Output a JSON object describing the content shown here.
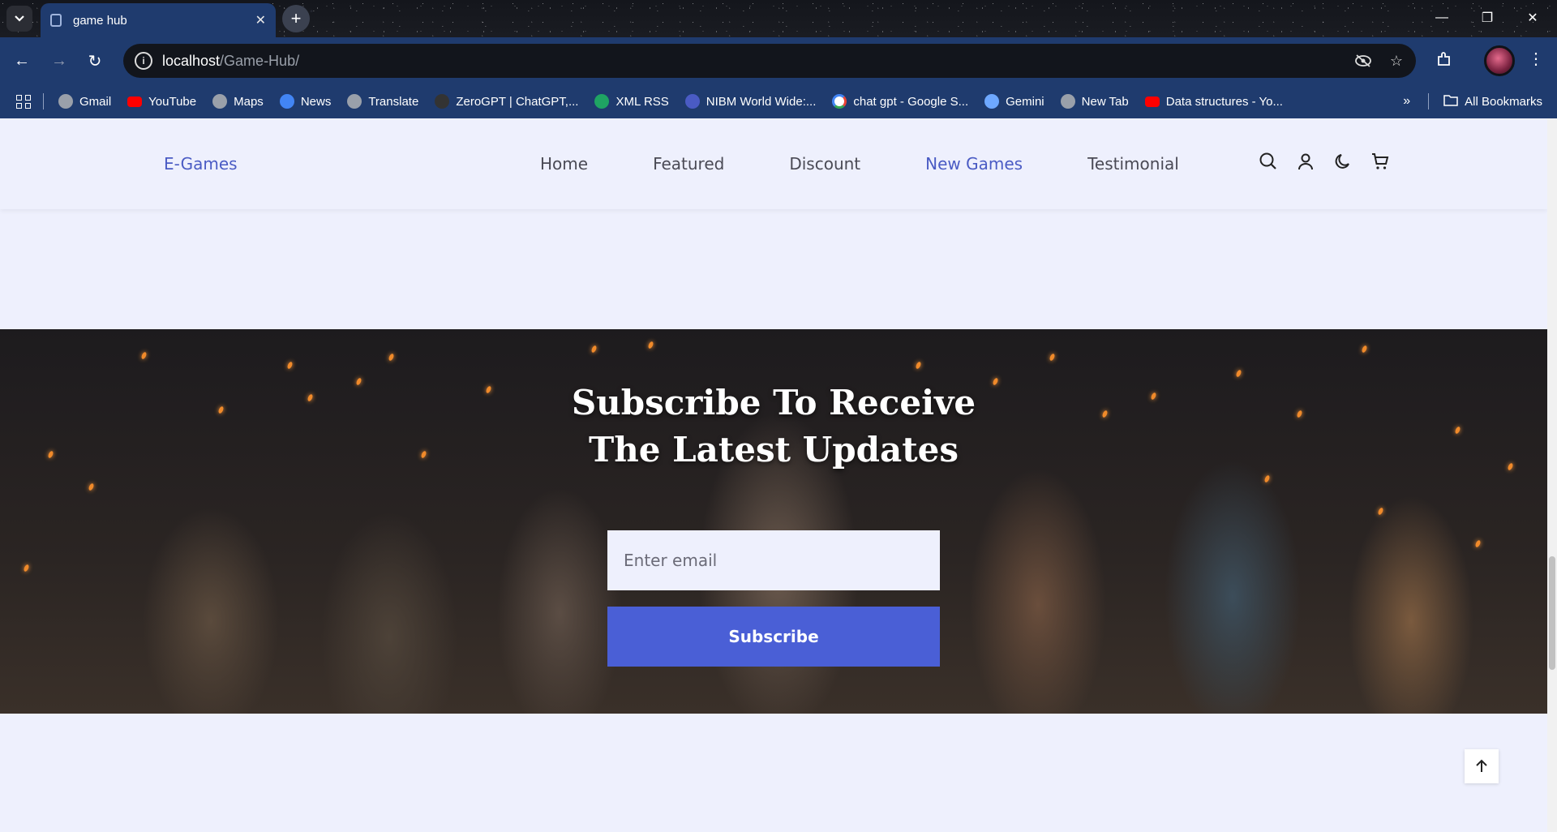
{
  "browser": {
    "tab_title": "game hub",
    "url_host": "localhost",
    "url_path": "/Game-Hub/",
    "bookmarks": [
      {
        "label": "Gmail",
        "icon": "globe-icon",
        "color": "#9aa0aa"
      },
      {
        "label": "YouTube",
        "icon": "youtube-icon",
        "color": "#ff0000"
      },
      {
        "label": "Maps",
        "icon": "globe-icon",
        "color": "#9aa0aa"
      },
      {
        "label": "News",
        "icon": "google-news-icon",
        "color": "#4285f4"
      },
      {
        "label": "Translate",
        "icon": "globe-icon",
        "color": "#9aa0aa"
      },
      {
        "label": "ZeroGPT | ChatGPT,...",
        "icon": "zerogpt-icon",
        "color": "#333333"
      },
      {
        "label": "XML RSS",
        "icon": "w-icon",
        "color": "#1fa463"
      },
      {
        "label": "NIBM World Wide:...",
        "icon": "nibm-icon",
        "color": "#4a5bc4"
      },
      {
        "label": "chat gpt - Google S...",
        "icon": "google-icon",
        "color": "#ffffff"
      },
      {
        "label": "Gemini",
        "icon": "gemini-icon",
        "color": "#6ea8ff"
      },
      {
        "label": "New Tab",
        "icon": "globe-icon",
        "color": "#9aa0aa"
      },
      {
        "label": "Data structures - Yo...",
        "icon": "youtube-icon",
        "color": "#ff0000"
      }
    ],
    "all_bookmarks": "All Bookmarks"
  },
  "site": {
    "logo": "E-Games",
    "nav": [
      "Home",
      "Featured",
      "Discount",
      "New Games",
      "Testimonial"
    ],
    "active_nav": "New Games",
    "accent": "#4a5bc4"
  },
  "hero": {
    "title_line1": "Subscribe To Receive",
    "title_line2": "The Latest Updates",
    "email_placeholder": "Enter email",
    "button_label": "Subscribe",
    "button_color": "#4a5fd6"
  }
}
